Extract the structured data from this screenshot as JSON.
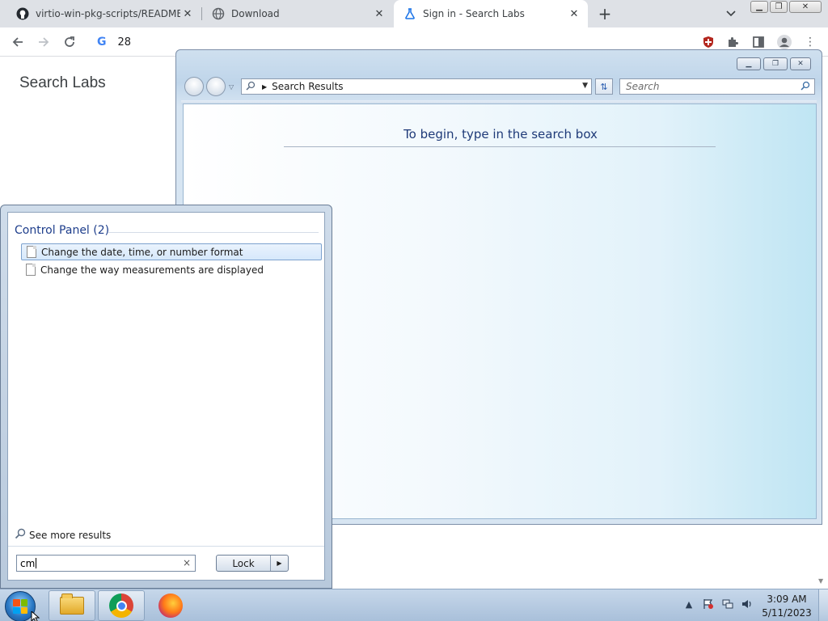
{
  "browser": {
    "tabs": [
      {
        "title": "virtio-win-pkg-scripts/README.m",
        "icon": "github-icon"
      },
      {
        "title": "Download",
        "icon": "globe-icon"
      },
      {
        "title": "Sign in - Search Labs",
        "icon": "flask-icon",
        "active": true
      }
    ],
    "address": "28",
    "page_title": "Search Labs"
  },
  "explorer": {
    "address": "Search Results",
    "search_placeholder": "Search",
    "message": "To begin, type in the search box"
  },
  "start_menu": {
    "group_title": "Control Panel (2)",
    "results": [
      "Change the date, time, or number format",
      "Change the way measurements are displayed"
    ],
    "see_more": "See more results",
    "search_value": "cm",
    "clear_icon": "×",
    "power_button": "Lock"
  },
  "taskbar": {
    "time": "3:09 AM",
    "date": "5/11/2023",
    "apps": [
      "start-orb",
      "windows-explorer",
      "google-chrome",
      "firefox"
    ]
  },
  "colors": {
    "chrome_tabbar": "#dee1e6",
    "explorer_text": "#1e3a78",
    "start_group": "#1e3e8c",
    "taskbar": "#b8cce2"
  }
}
